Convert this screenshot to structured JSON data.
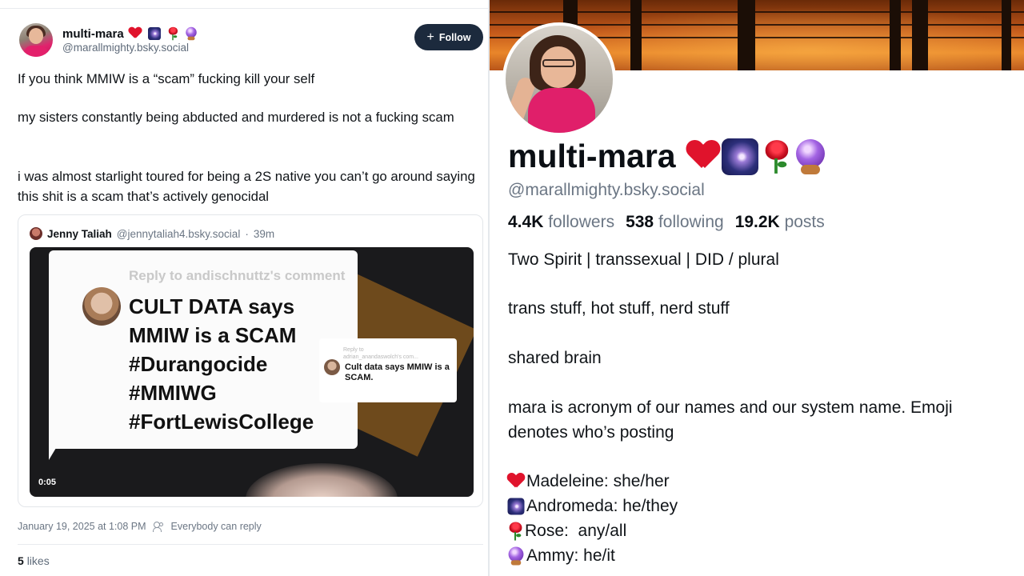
{
  "post": {
    "author_name": "multi-mara",
    "author_handle": "@marallmighty.bsky.social",
    "name_emojis": [
      "heart-emoji",
      "galaxy-emoji",
      "rose-emoji",
      "crystal-ball-emoji"
    ],
    "follow_label": "Follow",
    "paragraphs": [
      "If you think MMIW is a “scam” fucking kill your self",
      "my sisters constantly being abducted and murdered is not a fucking scam",
      "i was almost starlight toured for being a 2S native you can’t go around saying this shit is a scam that’s actively genocidal"
    ],
    "quote": {
      "author": "Jenny Taliah",
      "handle": "@jennytaliah4.bsky.social",
      "time": "39m",
      "video": {
        "reply_to": "Reply to andischnuttz's comment",
        "lines": [
          "CULT DATA says",
          "MMIW is a SCAM",
          "#Durangocide",
          "#MMIWG",
          "#FortLewisCollege"
        ],
        "mini_reply": "Reply to",
        "mini_reply_sub": "adrian_anandaswolch's com...",
        "mini_text": "Cult data says MMIW is a SCAM.",
        "timestamp": "0:05"
      }
    },
    "date": "January 19, 2025 at 1:08 PM",
    "reply_setting": "Everybody can reply",
    "likes_count": "5",
    "likes_label": "likes"
  },
  "profile": {
    "name": "multi-mara",
    "handle": "@marallmighty.bsky.social",
    "followers_count": "4.4K",
    "followers_label": "followers",
    "following_count": "538",
    "following_label": "following",
    "posts_count": "19.2K",
    "posts_label": "posts",
    "bio_line1": "Two Spirit | transsexual | DID / plural",
    "bio_line2": "trans stuff, hot stuff, nerd stuff",
    "bio_line3": "shared brain",
    "bio_line4a": "mara is acronym of our names and our system name. Emoji",
    "bio_line4b": "denotes who’s posting",
    "members": [
      {
        "icon": "heart-emoji",
        "text": "Madeleine: she/her"
      },
      {
        "icon": "galaxy-emoji",
        "text": "Andromeda: he/they"
      },
      {
        "icon": "rose-emoji",
        "text": "Rose:  any/all"
      },
      {
        "icon": "crystal-ball-emoji",
        "text": "Ammy: he/it"
      }
    ]
  },
  "colors": {
    "follow_button": "#1c2a3d",
    "handle_gray": "#6b7684",
    "accent_pink": "#e01f6a",
    "banner_orange": "#e9862a"
  }
}
